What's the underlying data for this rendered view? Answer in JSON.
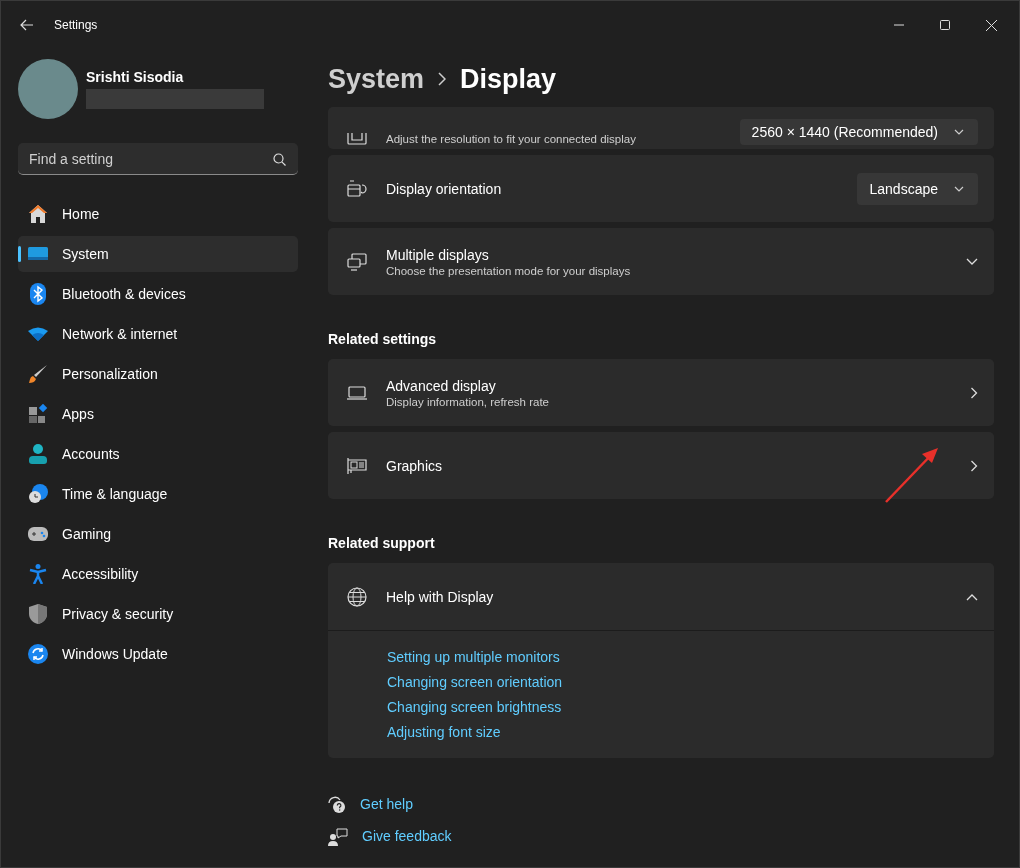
{
  "window": {
    "title": "Settings"
  },
  "user": {
    "name": "Srishti Sisodia"
  },
  "search": {
    "placeholder": "Find a setting"
  },
  "nav": [
    {
      "label": "Home",
      "selected": false
    },
    {
      "label": "System",
      "selected": true
    },
    {
      "label": "Bluetooth & devices",
      "selected": false
    },
    {
      "label": "Network & internet",
      "selected": false
    },
    {
      "label": "Personalization",
      "selected": false
    },
    {
      "label": "Apps",
      "selected": false
    },
    {
      "label": "Accounts",
      "selected": false
    },
    {
      "label": "Time & language",
      "selected": false
    },
    {
      "label": "Gaming",
      "selected": false
    },
    {
      "label": "Accessibility",
      "selected": false
    },
    {
      "label": "Privacy & security",
      "selected": false
    },
    {
      "label": "Windows Update",
      "selected": false
    }
  ],
  "breadcrumb": [
    "System",
    "Display"
  ],
  "sections": [
    {
      "cards": [
        {
          "kind": "dropdown",
          "subtitle": "Adjust the resolution to fit your connected display",
          "value": "2560 × 1440 (Recommended)"
        },
        {
          "kind": "dropdown",
          "title": "Display orientation",
          "value": "Landscape"
        },
        {
          "kind": "expander",
          "title": "Multiple displays",
          "subtitle": "Choose the presentation mode for your displays",
          "expanded": false
        }
      ]
    },
    {
      "heading": "Related settings",
      "cards": [
        {
          "kind": "link",
          "title": "Advanced display",
          "subtitle": "Display information, refresh rate"
        },
        {
          "kind": "link",
          "title": "Graphics"
        }
      ]
    },
    {
      "heading": "Related support",
      "cards": [
        {
          "kind": "expander",
          "title": "Help with Display",
          "expanded": true,
          "links": [
            "Setting up multiple monitors",
            "Changing screen orientation",
            "Changing screen brightness",
            "Adjusting font size"
          ]
        }
      ]
    }
  ],
  "footer": [
    {
      "label": "Get help"
    },
    {
      "label": "Give feedback"
    }
  ]
}
